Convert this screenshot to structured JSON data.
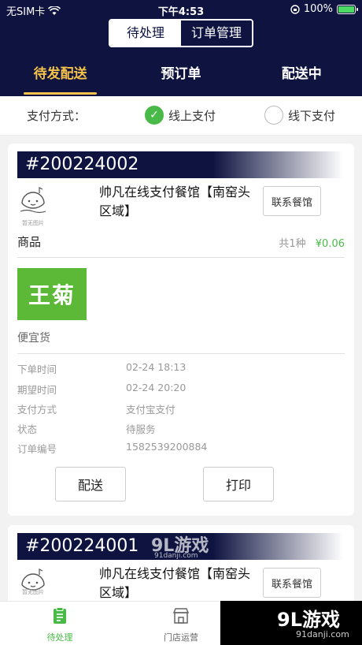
{
  "status_bar": {
    "carrier": "无SIM卡",
    "time": "下午4:53",
    "battery": "100%"
  },
  "segmented": {
    "left": "待处理",
    "right": "订单管理"
  },
  "tabs": [
    {
      "label": "待发配送"
    },
    {
      "label": "预订单"
    },
    {
      "label": "配送中"
    }
  ],
  "payment": {
    "label": "支付方式：",
    "online": "线上支付",
    "offline": "线下支付"
  },
  "orders": [
    {
      "order_no": "#200224002",
      "logo_caption": "暂无图片",
      "shop_name": "帅凡在线支付餐馆【南窑头区域】",
      "contact_label": "联系餐馆",
      "goods_title": "商品",
      "goods_count": "共1种",
      "goods_price": "¥0.06",
      "product_image_text": "王菊",
      "product_name": "便宜货",
      "info": [
        {
          "key": "下单时间",
          "value": "02-24 18:13"
        },
        {
          "key": "期望时间",
          "value": "02-24 20:20"
        },
        {
          "key": "支付方式",
          "value": "支付宝支付"
        },
        {
          "key": "状态",
          "value": "待服务"
        },
        {
          "key": "订单编号",
          "value": "1582539200884"
        }
      ],
      "deliver_label": "配送",
      "print_label": "打印"
    },
    {
      "order_no": "#200224001",
      "logo_caption": "暂无图片",
      "shop_name": "帅凡在线支付餐馆【南窑头区域】",
      "contact_label": "联系餐馆"
    }
  ],
  "bottom_nav": [
    {
      "label": "待处理"
    },
    {
      "label": "门店运营"
    }
  ],
  "watermark": {
    "main": "9L游戏",
    "sub": "91danji.com"
  },
  "colors": {
    "header": "#0e1340",
    "accent": "#f5c24a",
    "green": "#49b947"
  }
}
